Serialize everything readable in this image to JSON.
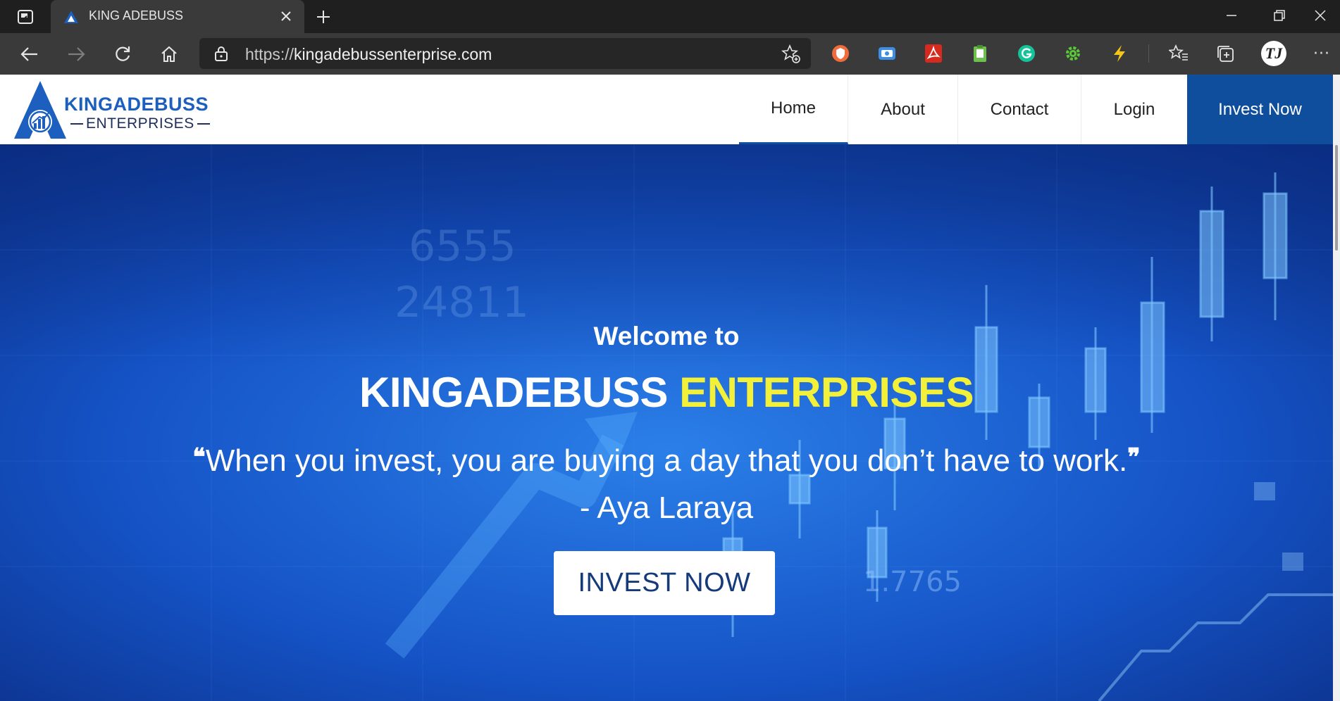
{
  "browser": {
    "tab_title": "KING ADEBUSS",
    "url_protocol": "https://",
    "url_host": "kingadebussenterprise.com",
    "profile_initials": "TJ",
    "more_label": "···"
  },
  "icons": {
    "tab_actions": "tab-actions-icon",
    "favicon": "site-logo-icon",
    "close": "close-icon",
    "new_tab": "plus-icon",
    "minimize": "minimize-icon",
    "restore": "restore-icon",
    "window_close": "close-icon",
    "back": "arrow-left-icon",
    "forward": "arrow-right-icon",
    "refresh": "refresh-icon",
    "home": "home-icon",
    "lock": "lock-icon",
    "add_favorite": "star-add-icon",
    "extensions": [
      "shield-extension-icon",
      "screen-capture-extension-icon",
      "pdf-extension-icon",
      "clipboard-extension-icon",
      "grammarly-extension-icon",
      "gear-extension-icon",
      "lightning-extension-icon"
    ],
    "favorites": "favorites-icon",
    "collections": "collections-icon"
  },
  "site": {
    "brand_line1": "KINGADEBUSS",
    "brand_line2": "ENTERPRISES",
    "nav": {
      "home": "Home",
      "about": "About",
      "contact": "Contact",
      "login": "Login",
      "cta": "Invest Now"
    },
    "hero": {
      "welcome": "Welcome to",
      "heading_main": "KINGADEBUSS",
      "heading_accent": "ENTERPRISES",
      "quote": "When you invest, you are buying a day that you don’t have to work.",
      "quote_open": "❝",
      "quote_close": "❞",
      "author": "- Aya Laraya",
      "button": "INVEST NOW"
    }
  },
  "colors": {
    "brand_blue": "#0f4e9d",
    "accent_yellow": "#f3f03a",
    "hero_blue": "#0d3fa8"
  }
}
